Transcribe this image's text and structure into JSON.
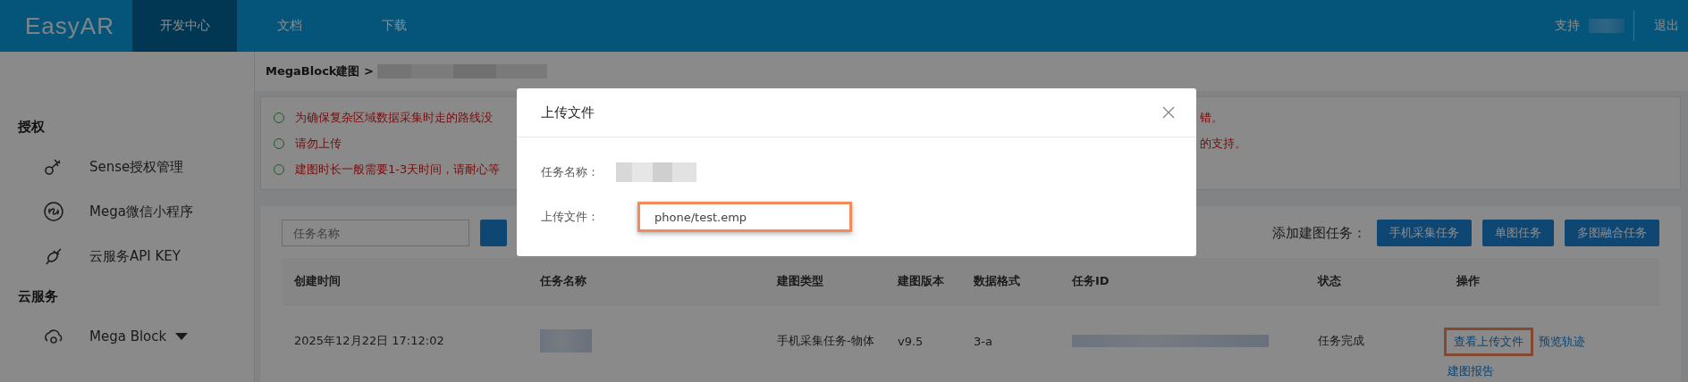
{
  "header": {
    "logo": "EasyAR",
    "nav": [
      {
        "label": "开发中心",
        "selected": true
      },
      {
        "label": "文档",
        "selected": false
      },
      {
        "label": "下载",
        "selected": false
      }
    ],
    "support": "支持",
    "logout": "退出"
  },
  "sidebar": {
    "sections": [
      {
        "title": "授权",
        "items": [
          {
            "label": "Sense授权管理"
          },
          {
            "label": "Mega微信小程序"
          },
          {
            "label": "云服务API KEY"
          }
        ]
      },
      {
        "title": "云服务",
        "items": [
          {
            "label": "Mega Block",
            "expanded": false
          }
        ]
      }
    ]
  },
  "breadcrumb": "MegaBlock建图 >",
  "notices": [
    {
      "text": "为确保复杂区域数据采集时走的路线没",
      "tail": "错。"
    },
    {
      "text": "请勿上传",
      "tail": "的支持。"
    },
    {
      "text": "建图时长一般需要1-3天时间，请耐心等"
    }
  ],
  "toolbar": {
    "search_placeholder": "任务名称",
    "add_label": "添加建图任务：",
    "buttons": [
      "手机采集任务",
      "单图任务",
      "多图融合任务"
    ]
  },
  "table": {
    "columns": [
      "创建时间",
      "任务名称",
      "建图类型",
      "建图版本",
      "数据格式",
      "任务ID",
      "状态",
      "操作"
    ],
    "rows": [
      {
        "cells": [
          {
            "kind": "text",
            "text": "2025年12月22日 17:12:02"
          },
          {
            "kind": "redacted"
          },
          {
            "kind": "text",
            "text": "手机采集任务-物体"
          },
          {
            "kind": "text",
            "text": "v9.5"
          },
          {
            "kind": "text",
            "text": "3-a"
          },
          {
            "kind": "redacted"
          },
          {
            "kind": "text",
            "text": "任务完成"
          }
        ],
        "actions": [
          {
            "label": "查看上传文件",
            "highlighted": true
          },
          {
            "label": "预览轨迹",
            "highlighted": false
          },
          {
            "label": "建图报告",
            "highlighted": false
          }
        ]
      }
    ]
  },
  "modal": {
    "title": "上传文件",
    "fields": [
      {
        "kind": "redacted",
        "label": "任务名称："
      },
      {
        "kind": "input",
        "label": "上传文件：",
        "value": "phone/test.emp",
        "highlighted": true
      }
    ]
  }
}
